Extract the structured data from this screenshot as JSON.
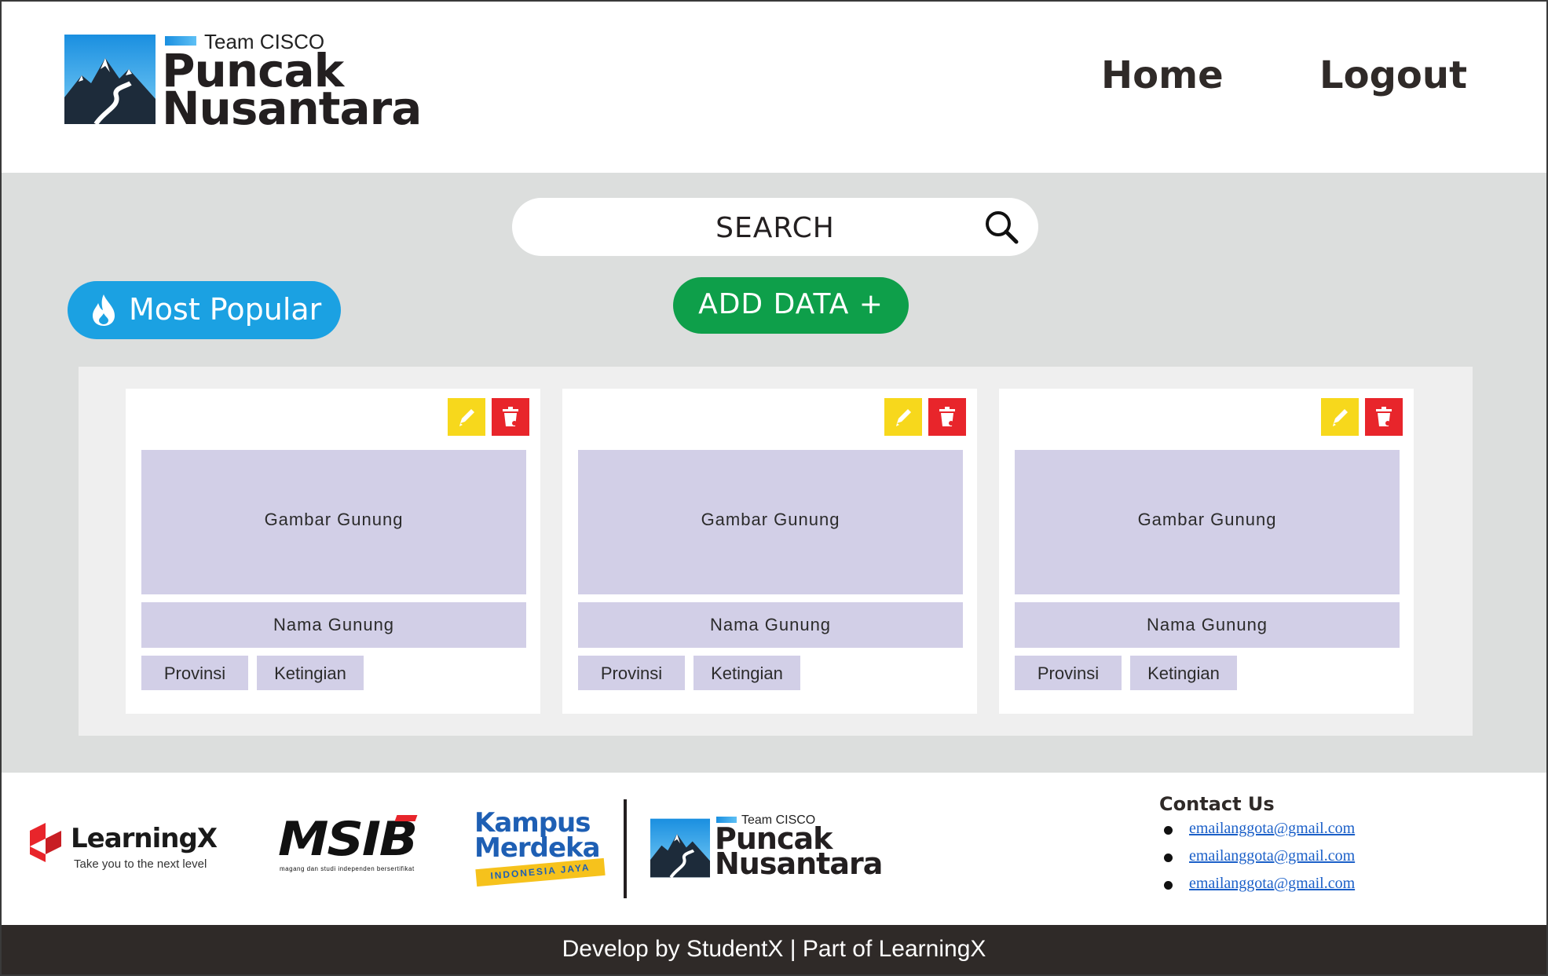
{
  "header": {
    "logo": {
      "team": "Team CISCO",
      "line1": "Puncak",
      "line2": "Nusantara"
    },
    "nav": {
      "home": "Home",
      "logout": "Logout"
    }
  },
  "toolbar": {
    "search_placeholder": "SEARCH",
    "most_popular_label": "Most Popular",
    "add_data_label": "ADD DATA +"
  },
  "cards": [
    {
      "image_label": "Gambar Gunung",
      "name": "Nama Gunung",
      "province": "Provinsi",
      "height": "Ketingian"
    },
    {
      "image_label": "Gambar Gunung",
      "name": "Nama Gunung",
      "province": "Provinsi",
      "height": "Ketingian"
    },
    {
      "image_label": "Gambar Gunung",
      "name": "Nama Gunung",
      "province": "Provinsi",
      "height": "Ketingian"
    }
  ],
  "footer": {
    "partners": {
      "learningx": {
        "name": "LearningX",
        "tagline": "Take you to the next level"
      },
      "msib": {
        "name": "MSIB",
        "subtitle": "magang dan studi independen bersertifikat"
      },
      "kampus_merdeka": {
        "line1": "Kampus",
        "line2": "Merdeka",
        "strip": "INDONESIA JAYA"
      }
    },
    "logo": {
      "team": "Team CISCO",
      "line1": "Puncak",
      "line2": "Nusantara"
    },
    "contact": {
      "title": "Contact Us",
      "emails": [
        "emailanggota@gmail.com",
        "emailanggota@gmail.com",
        "emailanggota@gmail.com"
      ]
    },
    "credit": "Develop by StudentX | Part of LearningX"
  },
  "colors": {
    "accent_blue": "#1ba1e2",
    "add_green": "#0e9f4a",
    "edit_yellow": "#f7d81c",
    "delete_red": "#e8252b",
    "placeholder_lavender": "#d2cfe7",
    "footer_bar": "#2f2a28"
  },
  "icons": {
    "search": "search-icon",
    "fire": "fire-icon",
    "edit": "pencil-icon",
    "delete": "trash-icon"
  }
}
